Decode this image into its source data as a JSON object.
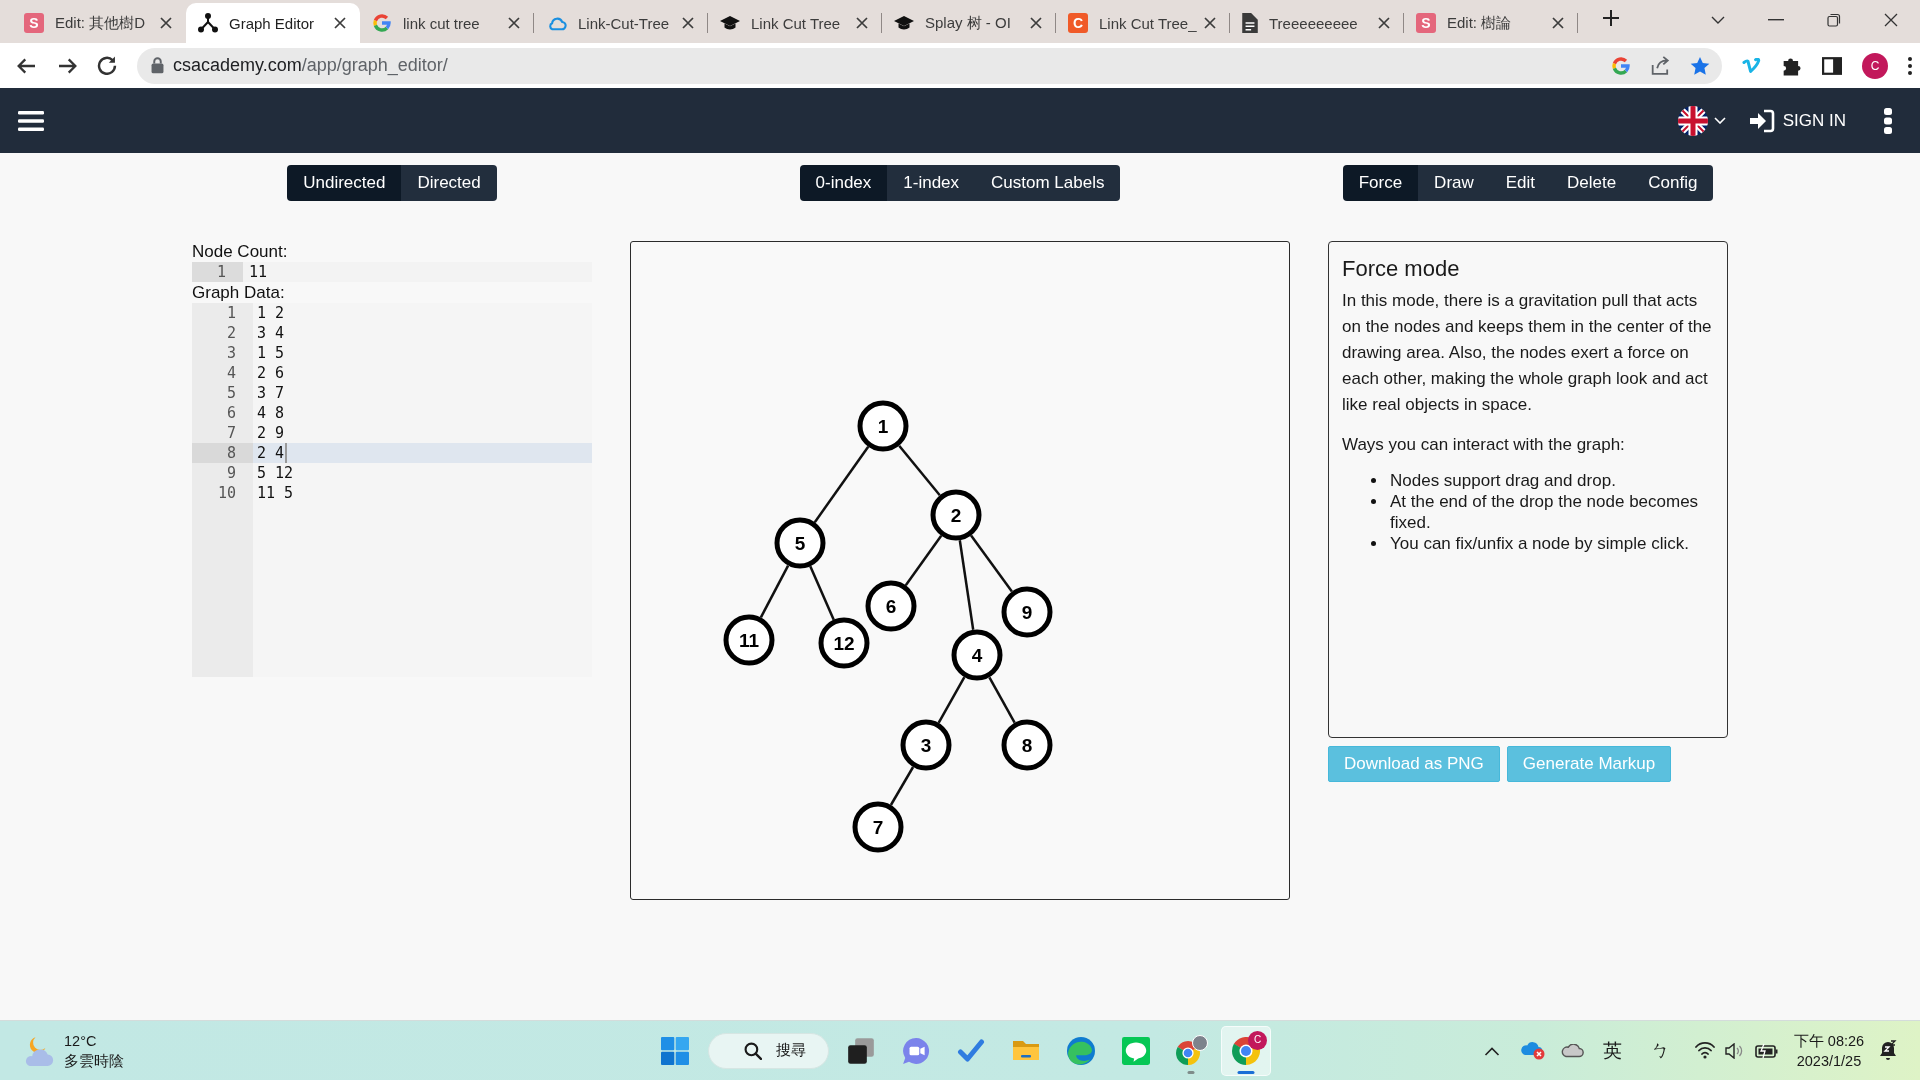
{
  "browser": {
    "tabs": [
      {
        "kind": "letter",
        "letter": "S",
        "color": "#e4677c",
        "title": "Edit: 其他樹D",
        "selected": false
      },
      {
        "kind": "graph",
        "title": "Graph Editor",
        "selected": true
      },
      {
        "kind": "google",
        "title": "link cut tree",
        "selected": false
      },
      {
        "kind": "cloud",
        "title": "Link-Cut-Tree",
        "selected": false
      },
      {
        "kind": "cap",
        "title": "Link Cut Tree",
        "selected": false
      },
      {
        "kind": "cap",
        "title": "Splay 树 - OI",
        "selected": false
      },
      {
        "kind": "letter",
        "letter": "C",
        "color": "#f05a28",
        "title": "Link Cut Tree_",
        "selected": false
      },
      {
        "kind": "doc",
        "title": "Treeeeeeeee",
        "selected": false
      },
      {
        "kind": "letter",
        "letter": "S",
        "color": "#e4677c",
        "title": "Edit: 樹論",
        "selected": false
      }
    ],
    "address": {
      "host": "csacademy.com",
      "path": "/app/graph_editor/",
      "bookmarked": true
    },
    "profile": {
      "initial": "C"
    }
  },
  "site_nav": {
    "sign_in": "SIGN IN"
  },
  "toolbar": {
    "graph_type": [
      {
        "label": "Undirected",
        "selected": true
      },
      {
        "label": "Directed",
        "selected": false
      }
    ],
    "labels": [
      {
        "label": "0-index",
        "selected": true
      },
      {
        "label": "1-index",
        "selected": false
      },
      {
        "label": "Custom Labels",
        "selected": false
      }
    ],
    "modes": [
      {
        "label": "Force",
        "selected": true
      },
      {
        "label": "Draw",
        "selected": false
      },
      {
        "label": "Edit",
        "selected": false
      },
      {
        "label": "Delete",
        "selected": false
      },
      {
        "label": "Config",
        "selected": false
      }
    ]
  },
  "editor": {
    "node_count": {
      "label": "Node Count:",
      "lines": [
        {
          "number": "1",
          "text": "11"
        }
      ]
    },
    "graph_data": {
      "label": "Graph Data:",
      "lines": [
        {
          "number": "1",
          "text": "1 2",
          "active": false
        },
        {
          "number": "2",
          "text": "3 4",
          "active": false
        },
        {
          "number": "3",
          "text": "1 5",
          "active": false
        },
        {
          "number": "4",
          "text": "2 6",
          "active": false
        },
        {
          "number": "5",
          "text": "3 7",
          "active": false
        },
        {
          "number": "6",
          "text": "4 8",
          "active": false
        },
        {
          "number": "7",
          "text": "2 9",
          "active": false
        },
        {
          "number": "8",
          "text": "2 4",
          "active": true
        },
        {
          "number": "9",
          "text": "5 12",
          "active": false
        },
        {
          "number": "10",
          "text": "11 5",
          "active": false
        }
      ]
    }
  },
  "graph": {
    "nodes": [
      "1",
      "2",
      "3",
      "4",
      "5",
      "6",
      "7",
      "8",
      "9",
      "11",
      "12"
    ]
  },
  "info": {
    "title": "Force mode",
    "text": "In this mode, there is a gravitation pull that acts on the nodes and keeps them in the center of the drawing area. Also, the nodes exert a force on each other, making the whole graph look and act like real objects in space.",
    "ways": "Ways you can interact with the graph:",
    "bullets": [
      "Nodes support drag and drop.",
      "At the end of the drop the node becomes fixed.",
      "You can fix/unfix a node by simple click."
    ]
  },
  "actions": [
    "Download as PNG",
    "Generate Markup"
  ],
  "taskbar": {
    "weather": {
      "temperature": "12°C",
      "condition": "多雲時陰"
    },
    "search": {
      "label": "搜尋"
    },
    "apps": [
      {
        "kind": "task-view",
        "open": false,
        "selected": false
      },
      {
        "kind": "chat",
        "open": false,
        "selected": false
      },
      {
        "kind": "todo",
        "open": false,
        "selected": false
      },
      {
        "kind": "folder",
        "open": false,
        "selected": false
      },
      {
        "kind": "edge",
        "open": false,
        "selected": false
      },
      {
        "kind": "line",
        "open": false,
        "selected": false
      },
      {
        "kind": "chrome-avatar",
        "open": true,
        "selected": false
      },
      {
        "kind": "chrome-letter",
        "badge": "C",
        "open": true,
        "selected": true
      }
    ],
    "tray": {
      "language": "英",
      "input_method": "ㄅ",
      "time": "下午 08:26",
      "date": "2023/1/25"
    }
  }
}
